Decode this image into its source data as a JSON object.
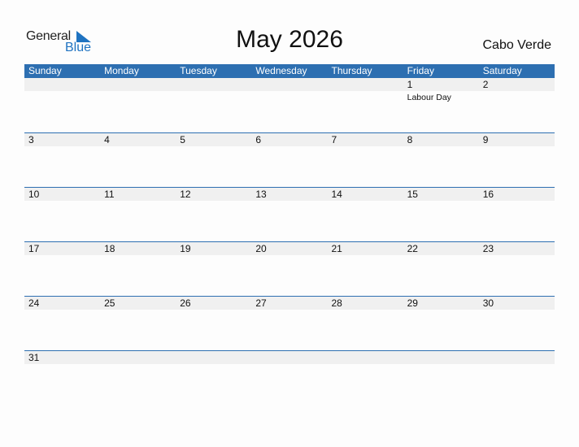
{
  "logo": {
    "word1": "General",
    "word2": "Blue",
    "accent_color": "#1f73c1"
  },
  "title": "May 2026",
  "country": "Cabo Verde",
  "header_color": "#2d6fb1",
  "weekdays": [
    "Sunday",
    "Monday",
    "Tuesday",
    "Wednesday",
    "Thursday",
    "Friday",
    "Saturday"
  ],
  "weeks": [
    [
      {
        "d": ""
      },
      {
        "d": ""
      },
      {
        "d": ""
      },
      {
        "d": ""
      },
      {
        "d": ""
      },
      {
        "d": "1",
        "event": "Labour Day"
      },
      {
        "d": "2"
      }
    ],
    [
      {
        "d": "3"
      },
      {
        "d": "4"
      },
      {
        "d": "5"
      },
      {
        "d": "6"
      },
      {
        "d": "7"
      },
      {
        "d": "8"
      },
      {
        "d": "9"
      }
    ],
    [
      {
        "d": "10"
      },
      {
        "d": "11"
      },
      {
        "d": "12"
      },
      {
        "d": "13"
      },
      {
        "d": "14"
      },
      {
        "d": "15"
      },
      {
        "d": "16"
      }
    ],
    [
      {
        "d": "17"
      },
      {
        "d": "18"
      },
      {
        "d": "19"
      },
      {
        "d": "20"
      },
      {
        "d": "21"
      },
      {
        "d": "22"
      },
      {
        "d": "23"
      }
    ],
    [
      {
        "d": "24"
      },
      {
        "d": "25"
      },
      {
        "d": "26"
      },
      {
        "d": "27"
      },
      {
        "d": "28"
      },
      {
        "d": "29"
      },
      {
        "d": "30"
      }
    ],
    [
      {
        "d": "31"
      },
      {
        "d": ""
      },
      {
        "d": ""
      },
      {
        "d": ""
      },
      {
        "d": ""
      },
      {
        "d": ""
      },
      {
        "d": ""
      }
    ]
  ]
}
